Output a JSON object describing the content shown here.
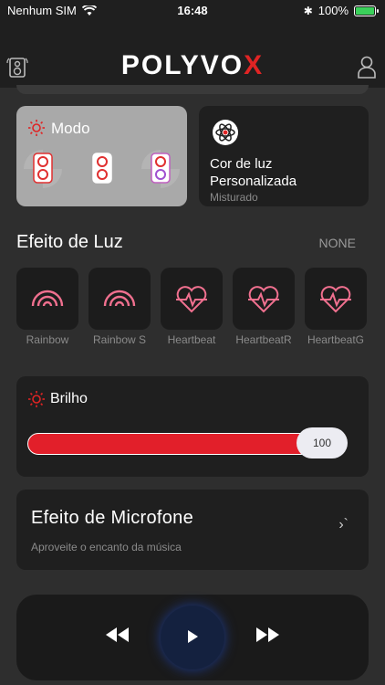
{
  "status": {
    "carrier": "Nenhum SIM",
    "time": "16:48",
    "battery": "100%"
  },
  "header": {
    "logo_main": "POLYVO",
    "logo_x": "X"
  },
  "mode_card": {
    "title": "Modo"
  },
  "custom_card": {
    "title_line1": "Cor de luz",
    "title_line2": "Personalizada",
    "subtitle": "Misturado"
  },
  "light_effect": {
    "title": "Efeito de Luz",
    "selected": "NONE",
    "items": [
      {
        "label": "Rainbow",
        "icon": "rainbow-icon"
      },
      {
        "label": "Rainbow S",
        "icon": "rainbow-icon"
      },
      {
        "label": "Heartbeat",
        "icon": "heartbeat-icon"
      },
      {
        "label": "HeartbeatR",
        "icon": "heartbeat-icon"
      },
      {
        "label": "HeartbeatG",
        "icon": "heartbeat-icon"
      }
    ]
  },
  "brightness": {
    "title": "Brilho",
    "value": "100"
  },
  "mic_effect": {
    "title": "Efeito de Microfone",
    "subtitle": "Aproveite o encanto da música",
    "arrow": "›`"
  },
  "colors": {
    "accent": "#e21f2a",
    "pink": "#f0708f",
    "card": "#1f1f1f"
  }
}
